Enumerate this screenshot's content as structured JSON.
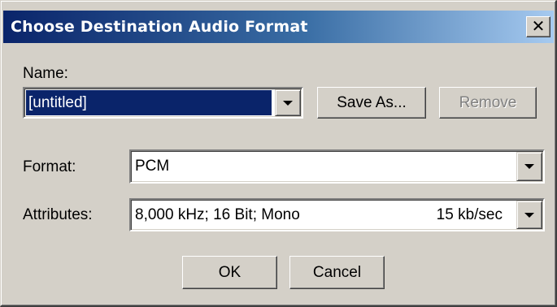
{
  "window": {
    "title": "Choose Destination Audio Format",
    "close_glyph": "✕",
    "close_icon": "close-icon"
  },
  "name_section": {
    "label": "Name:",
    "value": "[untitled]",
    "save_as_label": "Save As...",
    "remove_label": "Remove",
    "remove_enabled": false
  },
  "format": {
    "label": "Format:",
    "value": "PCM"
  },
  "attributes": {
    "label": "Attributes:",
    "value": "8,000 kHz; 16 Bit; Mono",
    "rate": "15 kb/sec"
  },
  "buttons": {
    "ok_label": "OK",
    "cancel_label": "Cancel"
  },
  "colors": {
    "titlebar_start": "#0a246a",
    "titlebar_end": "#a6caf0",
    "dialog_face": "#d4d0c8",
    "selection": "#0a246a"
  }
}
